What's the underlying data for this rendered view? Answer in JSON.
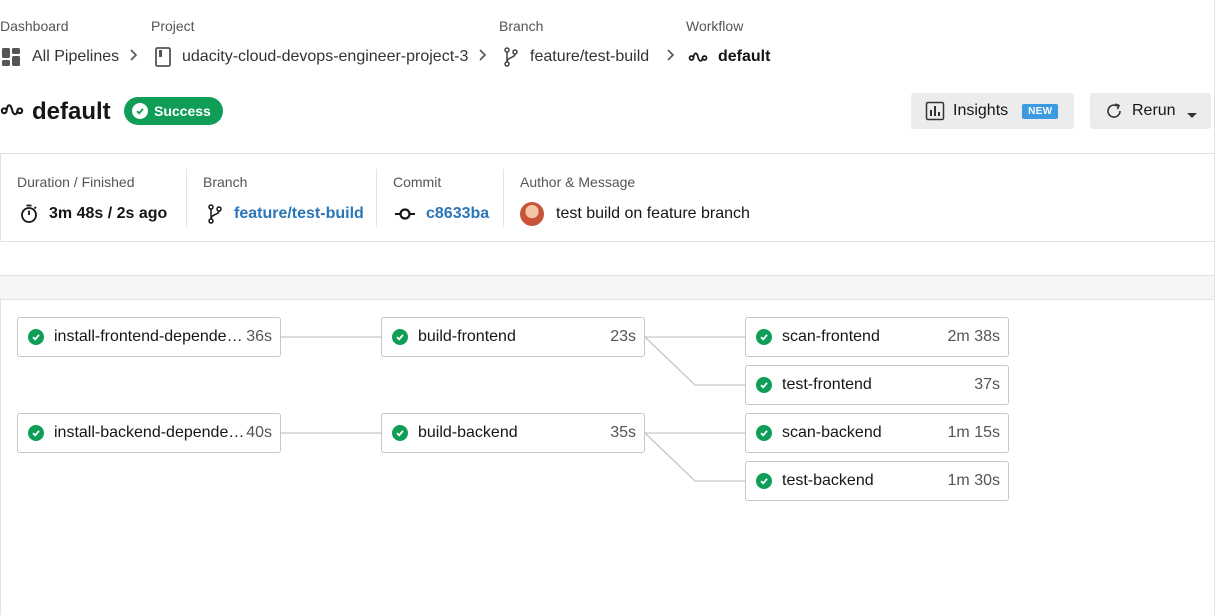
{
  "breadcrumb": {
    "dashboard": {
      "label": "Dashboard",
      "value": "All Pipelines"
    },
    "project": {
      "label": "Project",
      "value": "udacity-cloud-devops-engineer-project-3"
    },
    "branch": {
      "label": "Branch",
      "value": "feature/test-build"
    },
    "workflow": {
      "label": "Workflow",
      "value": "default"
    }
  },
  "header": {
    "title": "default",
    "status": "Success",
    "insights_label": "Insights",
    "new_badge": "NEW",
    "rerun_label": "Rerun"
  },
  "meta": {
    "duration_label": "Duration / Finished",
    "duration_value": "3m 48s / 2s ago",
    "branch_label": "Branch",
    "branch_value": "feature/test-build",
    "commit_label": "Commit",
    "commit_value": "c8633ba",
    "author_label": "Author & Message",
    "message": "test build on feature branch"
  },
  "jobs": [
    {
      "name": "install-frontend-dependencies",
      "duration": "36s",
      "status": "success"
    },
    {
      "name": "build-frontend",
      "duration": "23s",
      "status": "success"
    },
    {
      "name": "scan-frontend",
      "duration": "2m 38s",
      "status": "success"
    },
    {
      "name": "test-frontend",
      "duration": "37s",
      "status": "success"
    },
    {
      "name": "install-backend-dependencies",
      "duration": "40s",
      "status": "success"
    },
    {
      "name": "build-backend",
      "duration": "35s",
      "status": "success"
    },
    {
      "name": "scan-backend",
      "duration": "1m 15s",
      "status": "success"
    },
    {
      "name": "test-backend",
      "duration": "1m 30s",
      "status": "success"
    }
  ],
  "colors": {
    "success": "#0f9d58",
    "link": "#2a76b8",
    "new_badge": "#3b9ae1"
  }
}
